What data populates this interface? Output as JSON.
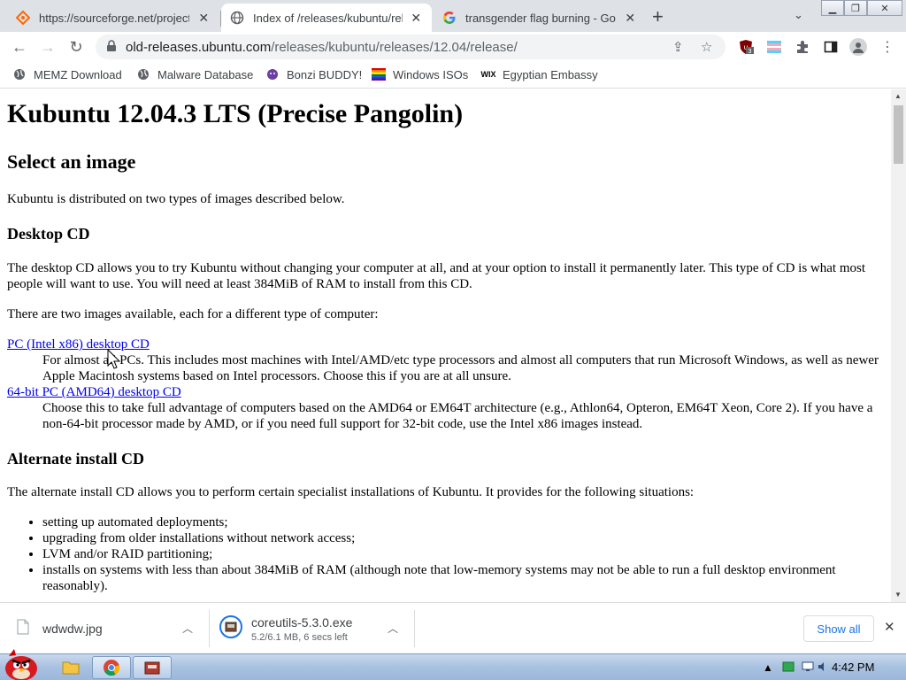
{
  "tabs": [
    {
      "title": "https://sourceforge.net/projects/",
      "active": false
    },
    {
      "title": "Index of /releases/kubuntu/releases/",
      "active": true
    },
    {
      "title": "transgender flag burning - Google Search",
      "active": false
    }
  ],
  "address_bar": {
    "host": "old-releases.ubuntu.com",
    "path": "/releases/kubuntu/releases/12.04/release/"
  },
  "extension_badge": "3",
  "bookmarks": [
    {
      "label": "MEMZ Download",
      "icon": "globe-icon"
    },
    {
      "label": "Malware Database",
      "icon": "globe-icon"
    },
    {
      "label": "Bonzi BUDDY!",
      "icon": "bonzi-icon"
    },
    {
      "label": "Windows ISOs",
      "icon": "rainbow-flag-icon"
    },
    {
      "label": "Egyptian Embassy",
      "icon": "wix-icon"
    }
  ],
  "page": {
    "title": "Kubuntu 12.04.3 LTS (Precise Pangolin)",
    "subtitle": "Select an image",
    "intro": "Kubuntu is distributed on two types of images described below.",
    "desktop_heading": "Desktop CD",
    "desktop_text": "The desktop CD allows you to try Kubuntu without changing your computer at all, and at your option to install it permanently later. This type of CD is what most people will want to use. You will need at least 384MiB of RAM to install from this CD.",
    "two_images": "There are two images available, each for a different type of computer:",
    "link_x86": "PC (Intel x86) desktop CD",
    "desc_x86": "For almost all PCs. This includes most machines with Intel/AMD/etc type processors and almost all computers that run Microsoft Windows, as well as newer Apple Macintosh systems based on Intel processors. Choose this if you are at all unsure.",
    "link_amd64": "64-bit PC (AMD64) desktop CD",
    "desc_amd64": "Choose this to take full advantage of computers based on the AMD64 or EM64T architecture (e.g., Athlon64, Opteron, EM64T Xeon, Core 2). If you have a non-64-bit processor made by AMD, or if you need full support for 32-bit code, use the Intel x86 images instead.",
    "alt_heading": "Alternate install CD",
    "alt_text": "The alternate install CD allows you to perform certain specialist installations of Kubuntu. It provides for the following situations:",
    "alt_items": [
      "setting up automated deployments;",
      "upgrading from older installations without network access;",
      "LVM and/or RAID partitioning;",
      "installs on systems with less than about 384MiB of RAM (although note that low-memory systems may not be able to run a full desktop environment reasonably)."
    ]
  },
  "downloads": [
    {
      "name": "wdwdw.jpg",
      "status": ""
    },
    {
      "name": "coreutils-5.3.0.exe",
      "status": "5.2/6.1 MB, 6 secs left"
    }
  ],
  "show_all": "Show all",
  "clock": "4:42 PM"
}
